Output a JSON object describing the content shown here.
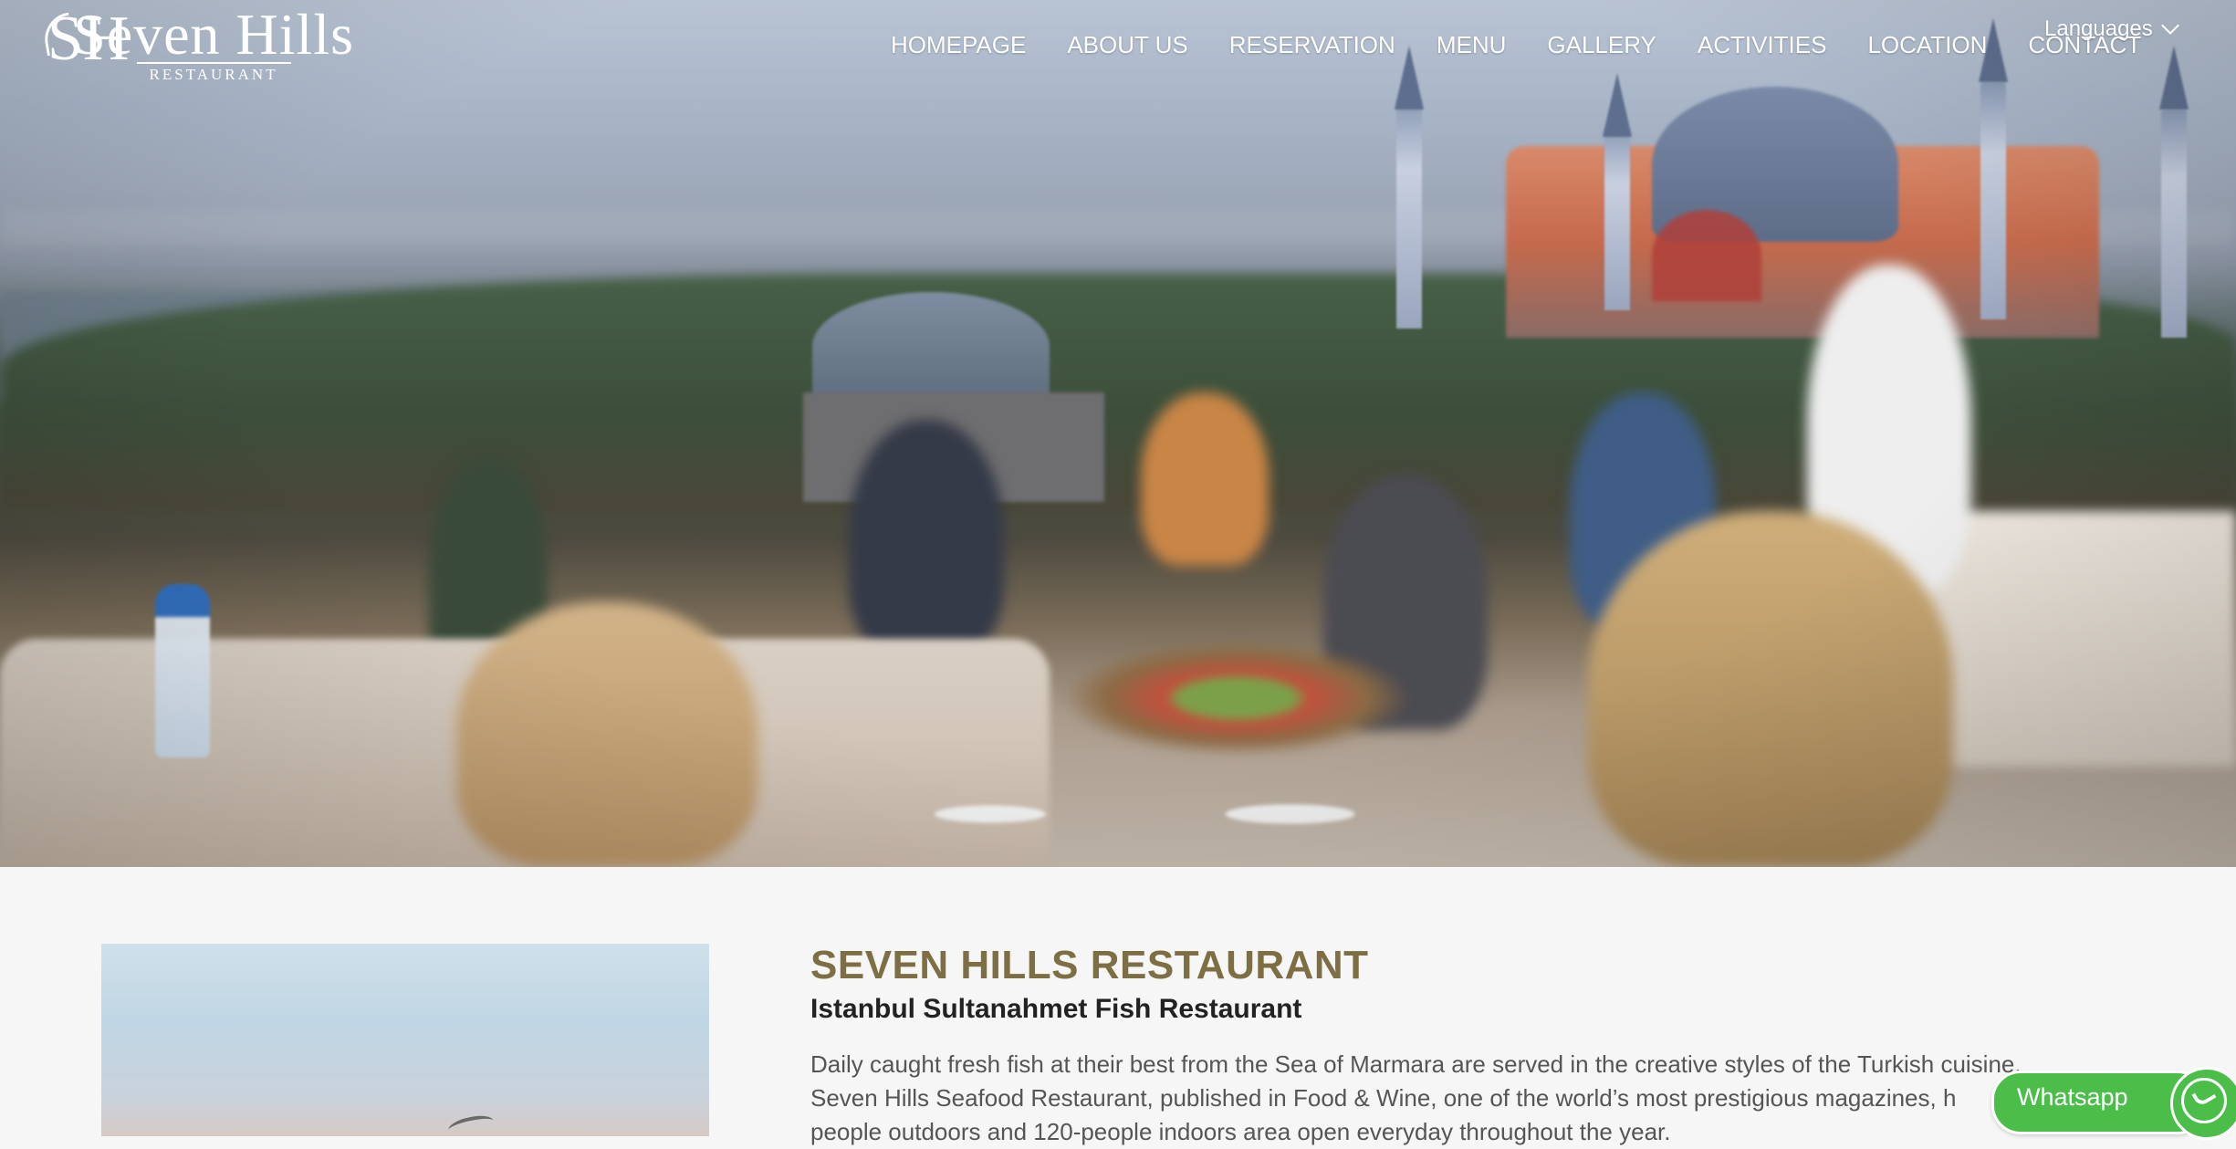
{
  "brand": {
    "logo_mark": "SH",
    "title": "Seven Hills",
    "subtitle": "RESTAURANT"
  },
  "nav": {
    "items": [
      "HOMEPAGE",
      "ABOUT US",
      "RESERVATION",
      "MENU",
      "GALLERY",
      "ACTIVITIES",
      "LOCATION",
      "CONTACT"
    ]
  },
  "languages": {
    "label": "Languages",
    "icon": "chevron-down-icon"
  },
  "hero": {
    "image": "rooftop-terrace-diners-hagia-sophia"
  },
  "intro": {
    "heading": "SEVEN HILLS RESTAURANT",
    "subheading": "Istanbul Sultanahmet Fish Restaurant",
    "paragraph_lines": [
      "Daily caught fresh fish at their best from the Sea of Marmara are served in the creative styles of the Turkish cuisine.",
      "Seven Hills Seafood Restaurant, published in Food & Wine, one of the world’s most prestigious magazines, h",
      "people outdoors and 120-people indoors area open everyday throughout the year."
    ]
  },
  "whatsapp": {
    "label": "Whatsapp",
    "icon": "whatsapp-icon"
  },
  "colors": {
    "heading_gold": "#7d6f43",
    "whatsapp_green": "#4bbe4a",
    "page_bg": "#f6f6f6"
  }
}
